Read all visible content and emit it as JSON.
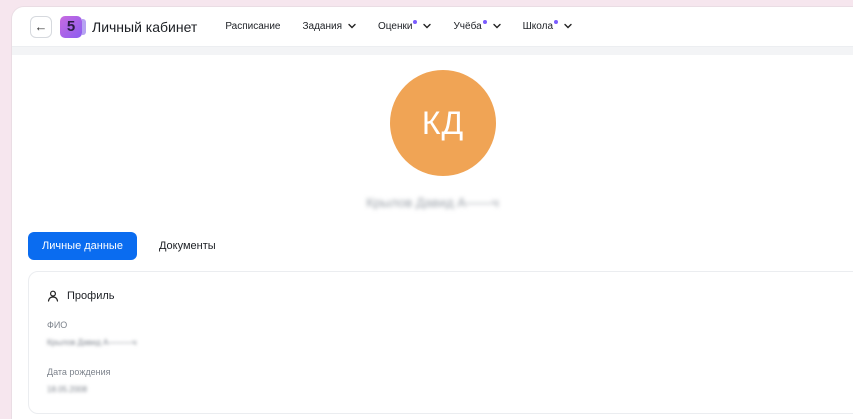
{
  "header": {
    "back_icon": "arrow-left-icon",
    "logo_text": "5",
    "title": "Личный кабинет",
    "nav": [
      {
        "label": "Расписание",
        "chevron": false,
        "dot": false
      },
      {
        "label": "Задания",
        "chevron": true,
        "dot": false
      },
      {
        "label": "Оценки",
        "chevron": true,
        "dot": true
      },
      {
        "label": "Учёба",
        "chevron": true,
        "dot": true
      },
      {
        "label": "Школа",
        "chevron": true,
        "dot": true
      }
    ]
  },
  "profile": {
    "initials": "КД",
    "full_name": "Крылов Давид А——ч",
    "avatar_color": "#f0a455"
  },
  "tabs": [
    {
      "label": "Личные данные",
      "active": true
    },
    {
      "label": "Документы",
      "active": false
    }
  ],
  "card": {
    "title": "Профиль",
    "icon": "person-icon",
    "fields": [
      {
        "label": "ФИО",
        "value": "Крылов Давид А———ч"
      },
      {
        "label": "Дата рождения",
        "value": "18.05.2008"
      }
    ]
  },
  "colors": {
    "accent": "#0a6cf0",
    "notification_dot": "#7b5cff",
    "background": "#f6e6ee"
  }
}
